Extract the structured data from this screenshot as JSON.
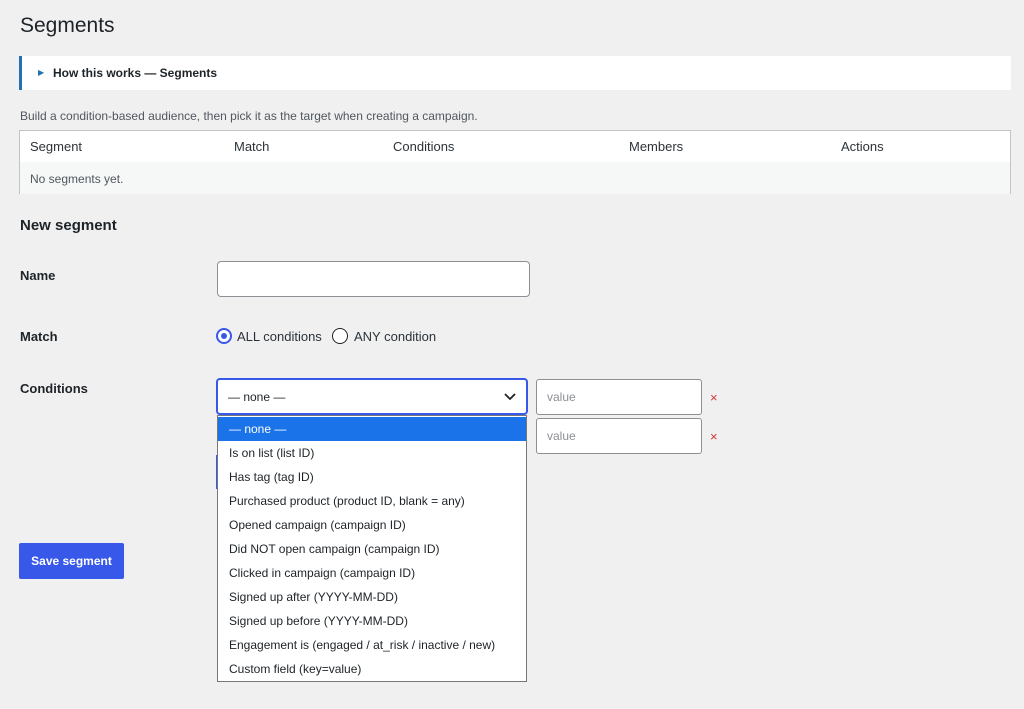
{
  "page_title": "Segments",
  "howto": {
    "label": "How this works — Segments"
  },
  "intro_text": "Build a condition-based audience, then pick it as the target when creating a campaign.",
  "table": {
    "headers": [
      "Segment",
      "Match",
      "Conditions",
      "Members",
      "Actions"
    ],
    "empty_text": "No segments yet."
  },
  "form": {
    "section_title": "New segment",
    "name_label": "Name",
    "name_value": "",
    "match_label": "Match",
    "match_options": [
      "ALL conditions",
      "ANY condition"
    ],
    "match_selected": "ALL conditions",
    "conditions_label": "Conditions",
    "condition_selected": "— none —",
    "value_placeholder": "value",
    "remove_symbol": "×",
    "save_label": "Save segment"
  },
  "dropdown_options": [
    "— none —",
    "Is on list (list ID)",
    "Has tag (tag ID)",
    "Purchased product (product ID, blank = any)",
    "Opened campaign (campaign ID)",
    "Did NOT open campaign (campaign ID)",
    "Clicked in campaign (campaign ID)",
    "Signed up after (YYYY-MM-DD)",
    "Signed up before (YYYY-MM-DD)",
    "Engagement is (engaged / at_risk / inactive / new)",
    "Custom field (key=value)"
  ],
  "colors": {
    "accent": "#3858e9",
    "link": "#2271b1",
    "remove": "#d63638",
    "selected_option": "#1a73e8"
  },
  "icons": {
    "expand": "triangle-right-icon",
    "dropdown": "chevron-down-icon",
    "remove": "close-icon"
  }
}
